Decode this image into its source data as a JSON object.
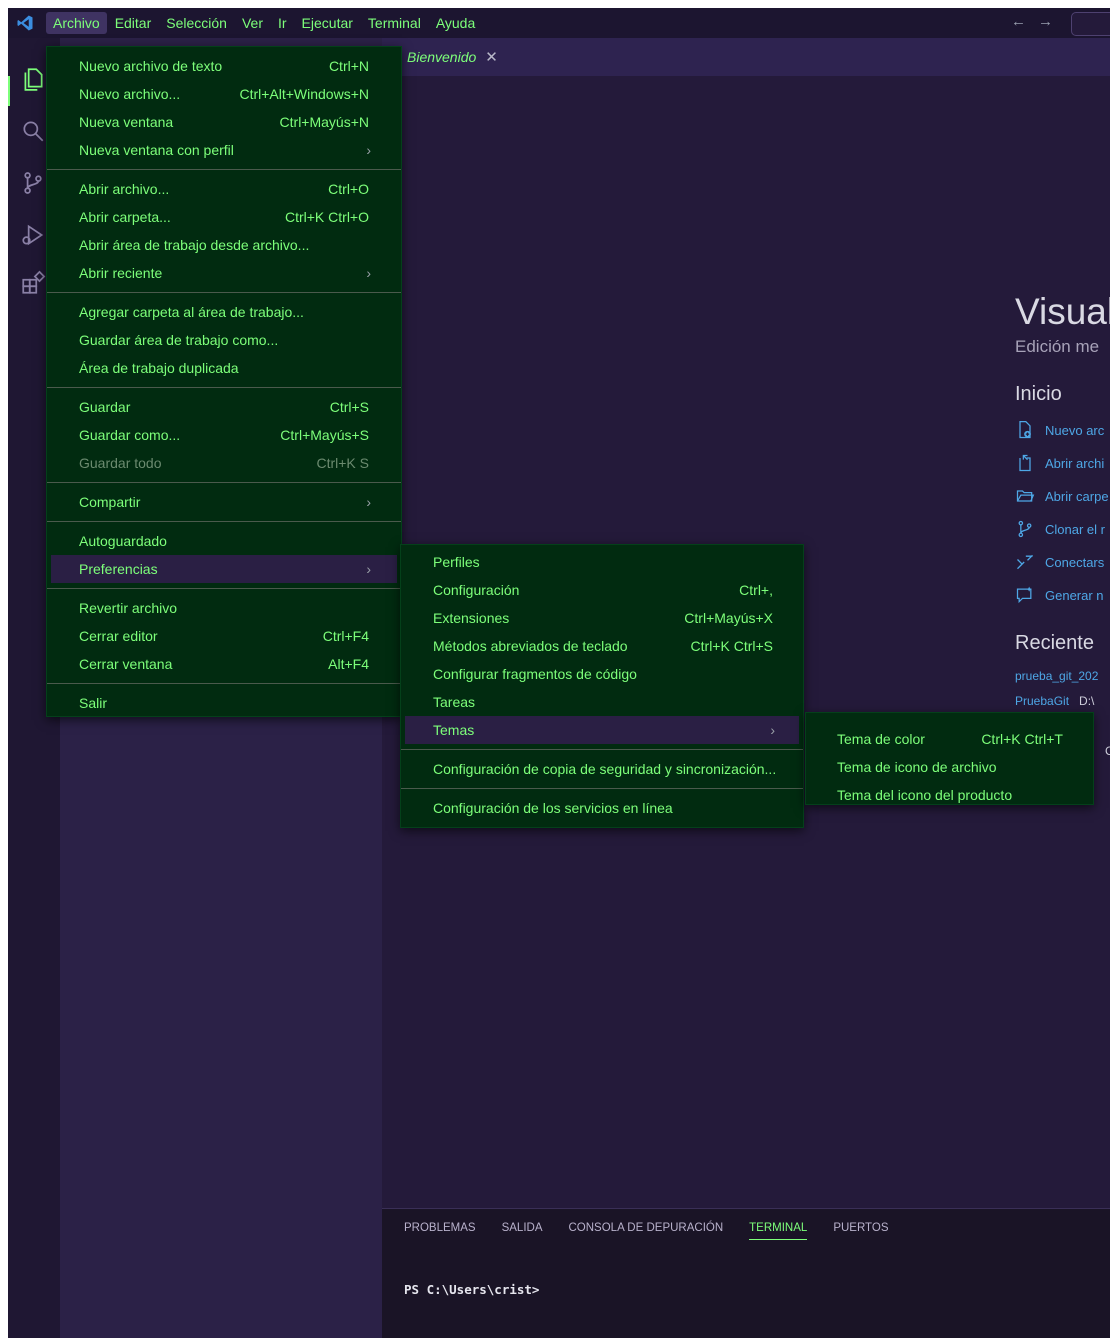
{
  "menubar": {
    "items": [
      "Archivo",
      "Editar",
      "Selección",
      "Ver",
      "Ir",
      "Ejecutar",
      "Terminal",
      "Ayuda"
    ],
    "active": "Archivo"
  },
  "nav": {
    "back": "←",
    "forward": "→"
  },
  "activity": {
    "items": [
      "explorer-icon",
      "search-icon",
      "source-control-icon",
      "run-debug-icon",
      "extensions-icon"
    ]
  },
  "tab": {
    "title": "Bienvenido",
    "close": "✕"
  },
  "welcome": {
    "title": "Visual",
    "subtitle": "Edición me",
    "start_heading": "Inicio",
    "start_items": [
      "Nuevo arc",
      "Abrir archi",
      "Abrir carpe",
      "Clonar el r",
      "Conectars",
      "Generar n"
    ],
    "recent_heading": "Reciente",
    "recent_items": [
      {
        "name": "prueba_git_202",
        "path": ""
      },
      {
        "name": "PruebaGit",
        "path": "D:\\"
      },
      {
        "name": "",
        "path": "C"
      },
      {
        "name": "",
        "path": "C:\\"
      }
    ]
  },
  "panel": {
    "tabs": [
      "PROBLEMAS",
      "SALIDA",
      "CONSOLA DE DEPURACIÓN",
      "TERMINAL",
      "PUERTOS"
    ],
    "active_tab": "TERMINAL",
    "prompt": "PS C:\\Users\\crist>"
  },
  "file_menu": {
    "items": [
      {
        "label": "Nuevo archivo de texto",
        "shortcut": "Ctrl+N"
      },
      {
        "label": "Nuevo archivo...",
        "shortcut": "Ctrl+Alt+Windows+N"
      },
      {
        "label": "Nueva ventana",
        "shortcut": "Ctrl+Mayús+N"
      },
      {
        "label": "Nueva ventana con perfil",
        "submenu": true
      },
      {
        "separator": true
      },
      {
        "label": "Abrir archivo...",
        "shortcut": "Ctrl+O"
      },
      {
        "label": "Abrir carpeta...",
        "shortcut": "Ctrl+K Ctrl+O"
      },
      {
        "label": "Abrir área de trabajo desde archivo..."
      },
      {
        "label": "Abrir reciente",
        "submenu": true
      },
      {
        "separator": true
      },
      {
        "label": "Agregar carpeta al área de trabajo..."
      },
      {
        "label": "Guardar área de trabajo como..."
      },
      {
        "label": "Área de trabajo duplicada"
      },
      {
        "separator": true
      },
      {
        "label": "Guardar",
        "shortcut": "Ctrl+S"
      },
      {
        "label": "Guardar como...",
        "shortcut": "Ctrl+Mayús+S"
      },
      {
        "label": "Guardar todo",
        "shortcut": "Ctrl+K S",
        "disabled": true
      },
      {
        "separator": true
      },
      {
        "label": "Compartir",
        "submenu": true
      },
      {
        "separator": true
      },
      {
        "label": "Autoguardado"
      },
      {
        "label": "Preferencias",
        "submenu": true,
        "highlighted": true
      },
      {
        "separator": true
      },
      {
        "label": "Revertir archivo"
      },
      {
        "label": "Cerrar editor",
        "shortcut": "Ctrl+F4"
      },
      {
        "label": "Cerrar ventana",
        "shortcut": "Alt+F4"
      },
      {
        "separator": true
      },
      {
        "label": "Salir"
      }
    ]
  },
  "prefs_menu": {
    "items": [
      {
        "label": "Perfiles"
      },
      {
        "label": "Configuración",
        "shortcut": "Ctrl+,"
      },
      {
        "label": "Extensiones",
        "shortcut": "Ctrl+Mayús+X"
      },
      {
        "label": "Métodos abreviados de teclado",
        "shortcut": "Ctrl+K Ctrl+S"
      },
      {
        "label": "Configurar fragmentos de código"
      },
      {
        "label": "Tareas"
      },
      {
        "label": "Temas",
        "submenu": true,
        "highlighted": true
      },
      {
        "separator": true
      },
      {
        "label": "Configuración de copia de seguridad y sincronización..."
      },
      {
        "separator": true
      },
      {
        "label": "Configuración de los servicios en línea"
      }
    ]
  },
  "themes_menu": {
    "items": [
      {
        "label": "Tema de color",
        "shortcut": "Ctrl+K Ctrl+T"
      },
      {
        "label": "Tema de icono de archivo"
      },
      {
        "label": "Tema del icono del producto"
      }
    ]
  },
  "colors": {
    "menu_bg": "#012b10",
    "menu_text": "#7dff7a",
    "editor_bg": "#241a3a",
    "link": "#4ea7e6"
  }
}
